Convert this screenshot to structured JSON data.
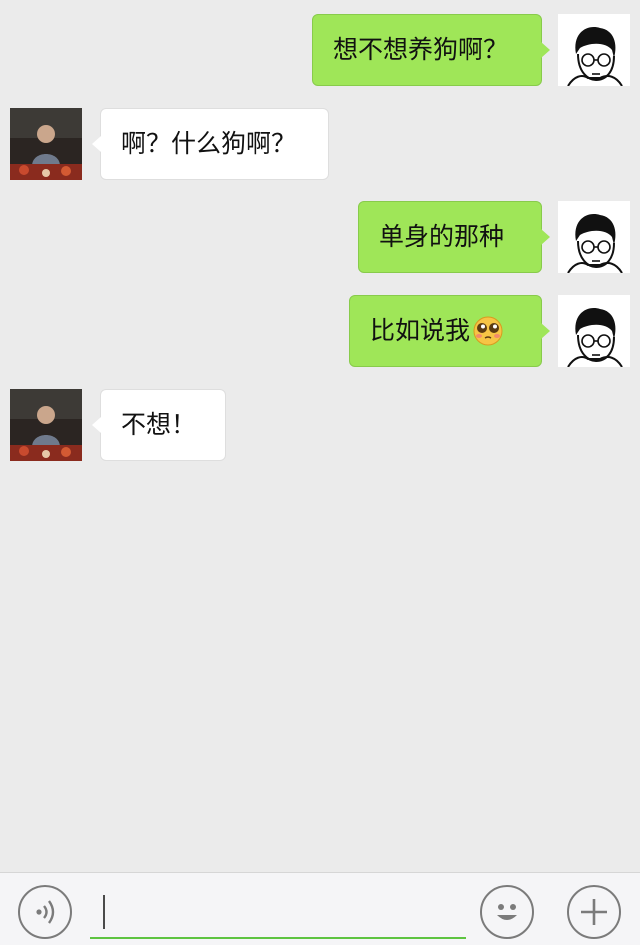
{
  "colors": {
    "background": "#ebebeb",
    "sent_bubble": "#9fe658",
    "received_bubble": "#ffffff",
    "input_focus_line": "#5ec441"
  },
  "messages": [
    {
      "sender": "me",
      "text": "想不想养狗啊？"
    },
    {
      "sender": "other",
      "text": "啊？什么狗啊？"
    },
    {
      "sender": "me",
      "text": "单身的那种"
    },
    {
      "sender": "me",
      "text": "比如说我",
      "emoji": "shy-face-emoji"
    },
    {
      "sender": "other",
      "text": "不想！"
    }
  ],
  "input_bar": {
    "text_value": "",
    "icons": [
      "voice-icon",
      "emoji-icon",
      "plus-icon"
    ]
  }
}
